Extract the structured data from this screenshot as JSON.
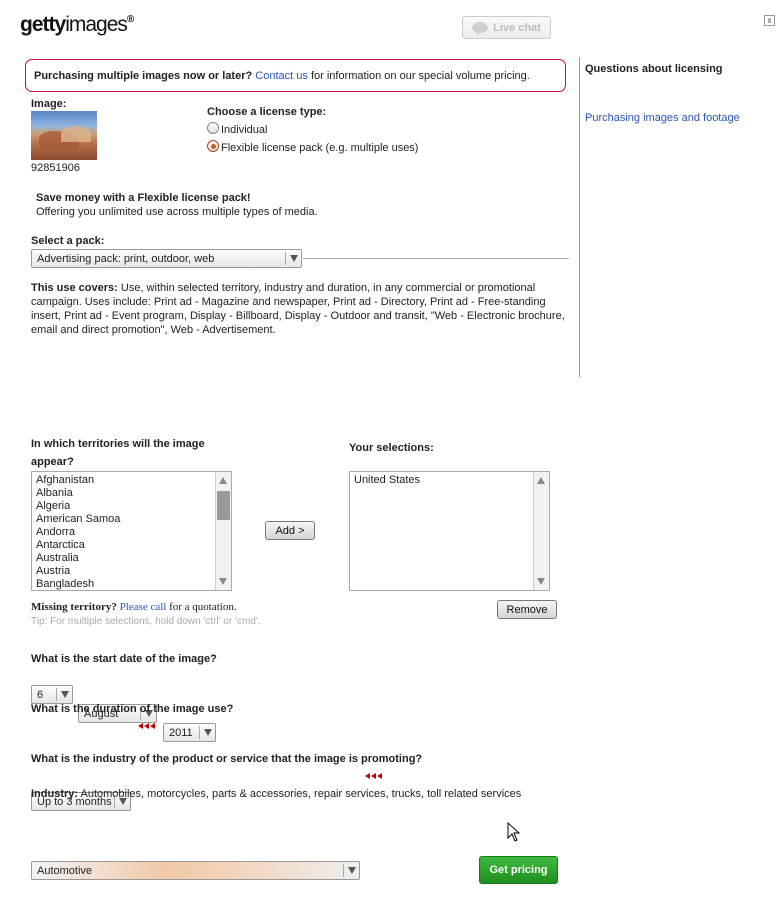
{
  "header": {
    "logo_bold": "getty",
    "logo_thin": "images",
    "logo_reg": "®",
    "live_chat": "Live chat",
    "close": "x"
  },
  "notice": {
    "bold": "Purchasing multiple images now or later?",
    "link": "Contact us",
    "rest": "for information on our special volume pricing."
  },
  "sidebar": {
    "title": "Questions about licensing",
    "link": "Purchasing images and footage"
  },
  "image": {
    "label": "Image:",
    "id": "92851906"
  },
  "license": {
    "label": "Choose a license type:",
    "options": [
      "Individual",
      "Flexible license pack (e.g. multiple uses)"
    ],
    "selected_index": 1
  },
  "promo": {
    "title": "Save money with a Flexible license pack!",
    "text": "Offering you unlimited use across multiple types of media."
  },
  "pack": {
    "label": "Select a pack:",
    "value": "Advertising pack: print, outdoor, web"
  },
  "use_covers": {
    "label": "This use covers:",
    "text": " Use, within selected territory, industry and duration, in any commercial or promotional campaign. Uses include: Print ad - Magazine and newspaper, Print ad - Directory, Print ad - Free-standing insert, Print ad - Event program, Display - Billboard, Display - Outdoor and transit, \"Web - Electronic brochure, email and direct promotion\", Web - Advertisement."
  },
  "territories": {
    "label_line1": "In which territories will the image",
    "label_line2": "appear?",
    "items": [
      "Afghanistan",
      "Albania",
      "Algeria",
      "American Samoa",
      "Andorra",
      "Antarctica",
      "Australia",
      "Austria",
      "Bangladesh"
    ],
    "add_button": "Add >",
    "selections_label": "Your selections:",
    "selections": [
      "United States"
    ],
    "remove_button": "Remove",
    "missing_bold": "Missing territory?",
    "missing_link": "Please call",
    "missing_rest": "for a quotation.",
    "tip": "Tip: For multiple selections, hold down 'ctrl' or 'cmd'."
  },
  "start_date": {
    "label": "What is the start date of the image?",
    "day": "6",
    "month": "August",
    "year": "2011"
  },
  "duration": {
    "label": "What is the duration of the image use?",
    "value": "Up to 3 months"
  },
  "industry": {
    "label": "What is the industry of the product or service that the image is promoting?",
    "value": "Automotive",
    "desc_label": "Industry:",
    "desc": " Automobiles, motorcycles, parts & accessories, repair services, trucks, toll related services"
  },
  "actions": {
    "get_pricing": "Get pricing"
  },
  "colors": {
    "accent_red": "#c8102e",
    "link_blue": "#2a55b5",
    "button_green": "#2ea82e"
  }
}
